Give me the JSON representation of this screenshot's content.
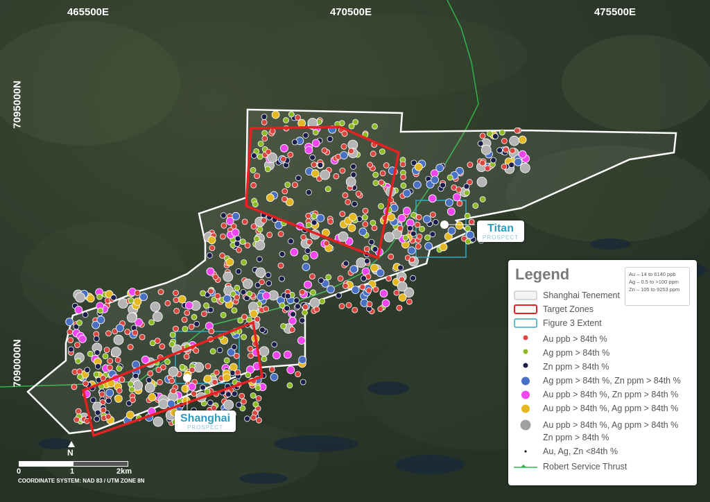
{
  "grid": {
    "eastings": [
      "465500E",
      "470500E",
      "475500E"
    ],
    "northings": [
      "7095000N",
      "7090000N"
    ]
  },
  "prospects": {
    "titan": {
      "name": "Titan",
      "tag": "PROSPECT"
    },
    "shanghai": {
      "name": "Shanghai",
      "tag": "PROSPECT"
    }
  },
  "legend": {
    "title": "Legend",
    "note": [
      "Au – 14 to 6140 ppb",
      "Ag – 0.5 to >100 ppm",
      "Zn – 105 to 9253 ppm"
    ],
    "items": [
      {
        "label": "Shanghai Tenement",
        "symbol": "white-box"
      },
      {
        "label": "Target Zones",
        "symbol": "red-box"
      },
      {
        "label": "Figure 3 Extent",
        "symbol": "cyan-box"
      },
      {
        "label": "Au ppb > 84th %",
        "symbol": "red-dot",
        "color": "#d9453f"
      },
      {
        "label": "Ag ppm > 84th %",
        "symbol": "green-dot",
        "color": "#8dbb23"
      },
      {
        "label": "Zn ppm > 84th %",
        "symbol": "navy-dot",
        "color": "#1b1d4a"
      },
      {
        "label": "Ag ppm > 84th %, Zn ppm > 84th %",
        "symbol": "blue-dot",
        "color": "#4a70c4"
      },
      {
        "label": "Au ppb > 84th %, Zn ppm > 84th %",
        "symbol": "magenta-dot",
        "color": "#f246f0"
      },
      {
        "label": "Au ppb > 84th %, Ag ppm > 84th %",
        "symbol": "yellow-dot",
        "color": "#e3b822"
      },
      {
        "label": "Au ppb > 84th %, Ag ppm > 84th %",
        "label2": "Zn ppm > 84th %",
        "symbol": "grey-dot",
        "color": "#a0a0a0"
      },
      {
        "label": "Au, Ag, Zn <84th %",
        "symbol": "black-point"
      },
      {
        "label": "Robert Service Thrust",
        "symbol": "green-line",
        "color": "#31b34b"
      }
    ]
  },
  "scale": {
    "labels": [
      "0",
      "1",
      "2km"
    ],
    "north": "N"
  },
  "coordinate_system": "COORDINATE SYSTEM: NAD 83 / UTM ZONE 8N"
}
